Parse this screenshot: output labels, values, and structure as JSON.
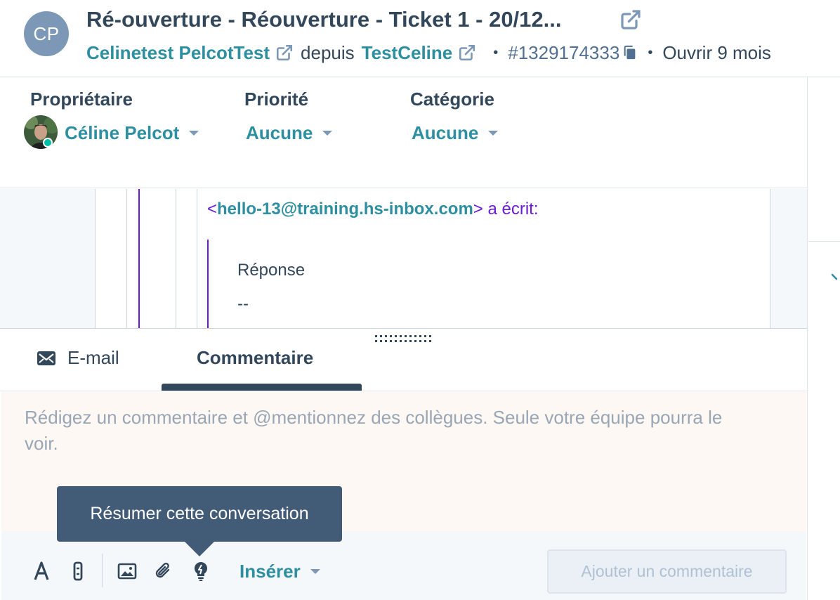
{
  "header": {
    "avatar_initials": "CP",
    "title": "Ré-ouverture - Réouverture - Ticket 1 - 20/12...",
    "contact_name": "Celinetest PelcotTest",
    "from_word": "depuis",
    "company_name": "TestCeline",
    "bullet": "•",
    "ticket_id": "#1329174333",
    "open_status": "Ouvrir 9 mois"
  },
  "properties": {
    "owner_label": "Propriétaire",
    "owner_value": "Céline Pelcot",
    "priority_label": "Priorité",
    "priority_value": "Aucune",
    "category_label": "Catégorie",
    "category_value": "Aucune"
  },
  "thread": {
    "open_bracket": "<",
    "sender_email": "hello-13@training.hs-inbox.com",
    "close_wrote": "> a écrit:",
    "reply_text": "Réponse",
    "signature_dashes": "--"
  },
  "composer": {
    "tab_email": "E-mail",
    "tab_comment": "Commentaire",
    "placeholder": "Rédigez un commentaire et @mentionnez des collègues. Seule votre équipe pourra le voir.",
    "insert_label": "Insérer",
    "add_comment_button": "Ajouter un commentaire",
    "tooltip": "Résumer cette conversation"
  },
  "colors": {
    "accent": "#2e8fa0",
    "text": "#33475b",
    "quote_purple": "#6a1bd5",
    "editor_bg": "#fdf8f3",
    "tooltip_bg": "#425b76"
  }
}
